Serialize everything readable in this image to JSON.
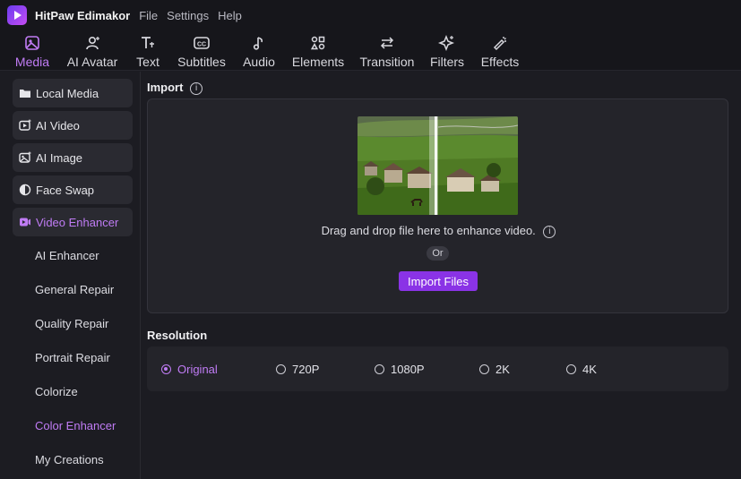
{
  "app": {
    "title": "HitPaw Edimakor",
    "menu": [
      "File",
      "Settings",
      "Help"
    ]
  },
  "toolbar": {
    "tabs": [
      {
        "label": "Media",
        "icon": "media-icon",
        "active": true
      },
      {
        "label": "AI Avatar",
        "icon": "avatar-icon"
      },
      {
        "label": "Text",
        "icon": "text-icon"
      },
      {
        "label": "Subtitles",
        "icon": "subtitles-icon"
      },
      {
        "label": "Audio",
        "icon": "audio-icon"
      },
      {
        "label": "Elements",
        "icon": "elements-icon"
      },
      {
        "label": "Transition",
        "icon": "transition-icon"
      },
      {
        "label": "Filters",
        "icon": "filters-icon"
      },
      {
        "label": "Effects",
        "icon": "effects-icon"
      }
    ]
  },
  "sidebar": {
    "items": [
      {
        "label": "Local Media",
        "icon": "folder-icon"
      },
      {
        "label": "AI Video",
        "icon": "ai-video-icon"
      },
      {
        "label": "AI Image",
        "icon": "ai-image-icon"
      },
      {
        "label": "Face Swap",
        "icon": "face-swap-icon"
      },
      {
        "label": "Video Enhancer",
        "icon": "video-enhancer-icon",
        "active": true
      }
    ],
    "sub_items": [
      {
        "label": "AI Enhancer"
      },
      {
        "label": "General Repair"
      },
      {
        "label": "Quality Repair"
      },
      {
        "label": "Portrait Repair"
      },
      {
        "label": "Colorize"
      },
      {
        "label": "Color Enhancer",
        "active": true
      },
      {
        "label": "My Creations"
      }
    ]
  },
  "import": {
    "title": "Import",
    "drag_text": "Drag and drop file here to enhance video.",
    "or_text": "Or",
    "button_label": "Import Files"
  },
  "resolution": {
    "title": "Resolution",
    "options": [
      {
        "label": "Original",
        "selected": true
      },
      {
        "label": "720P"
      },
      {
        "label": "1080P"
      },
      {
        "label": "2K"
      },
      {
        "label": "4K"
      }
    ]
  },
  "colors": {
    "accent": "#c07cf5",
    "button": "#8a33e6",
    "background": "#1c1c22",
    "panel": "#24242a"
  }
}
